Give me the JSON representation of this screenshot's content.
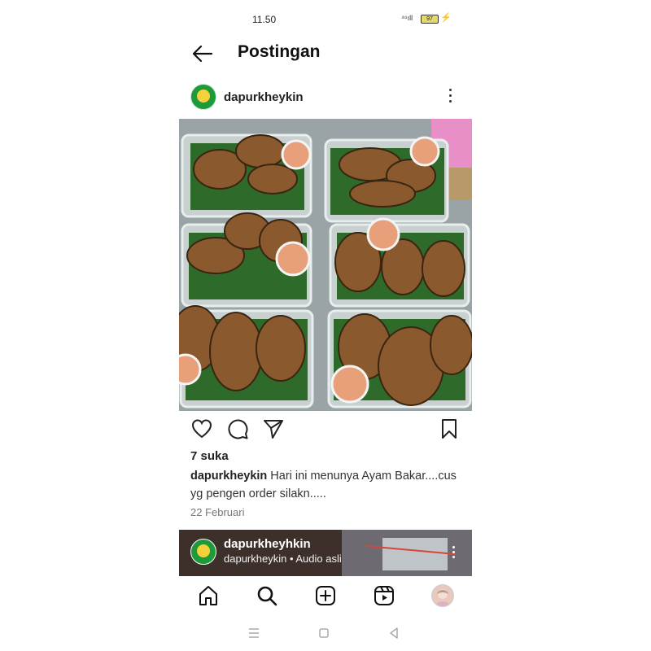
{
  "status_bar": {
    "time": "11.50",
    "signal": "⁴⁶ıll",
    "battery": "97",
    "charging_icon": "bolt-icon"
  },
  "header": {
    "title": "Postingan",
    "back_icon": "arrow-left-icon"
  },
  "post": {
    "username": "dapurkheykin",
    "more_icon": "more-vertical-icon",
    "image_alt": "Boxes of grilled chicken (ayam bakar) with sambal cups on banana leaves",
    "likes": "7 suka",
    "caption_user": "dapurkheykin",
    "caption_text": " Hari ini menunya Ayam Bakar....cus yg pengen order silakn.....",
    "date": "22 Februari",
    "actions": [
      "heart-icon",
      "comment-icon",
      "send-icon",
      "bookmark-icon"
    ]
  },
  "next_post": {
    "username": "dapurkheyhkin",
    "audio": "dapurkheykin • Audio asli"
  },
  "tab_bar": {
    "items": [
      "home-icon",
      "search-icon",
      "add-icon",
      "reels-icon",
      "profile-avatar"
    ]
  },
  "colors": {
    "brand_green": "#1f9a3b",
    "text": "#262626",
    "muted": "#777777"
  }
}
